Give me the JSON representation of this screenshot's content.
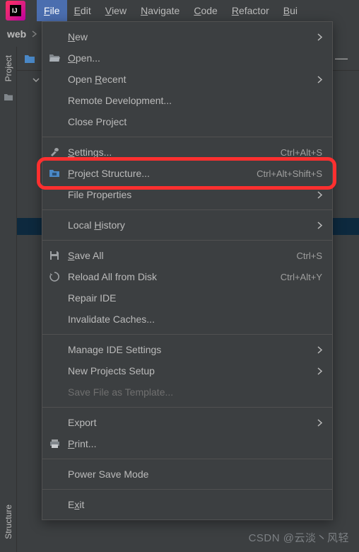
{
  "menubar": {
    "items": [
      "File",
      "Edit",
      "View",
      "Navigate",
      "Code",
      "Refactor",
      "Bui"
    ],
    "active_index": 0
  },
  "navbar": {
    "label": "web"
  },
  "sidebar": {
    "items": [
      {
        "label": "Project",
        "icon": "folder-icon"
      },
      {
        "label": "Structure",
        "icon": "structure-icon"
      }
    ]
  },
  "dropdown": {
    "items": [
      {
        "type": "item",
        "icon": "",
        "label": "New",
        "shortcut": "",
        "submenu": true,
        "mnemonic_idx": 0
      },
      {
        "type": "item",
        "icon": "folder-open-icon",
        "label": "Open...",
        "shortcut": "",
        "submenu": false,
        "mnemonic_idx": 0
      },
      {
        "type": "item",
        "icon": "",
        "label": "Open Recent",
        "shortcut": "",
        "submenu": true,
        "mnemonic_idx": 5
      },
      {
        "type": "item",
        "icon": "",
        "label": "Remote Development...",
        "shortcut": "",
        "submenu": false
      },
      {
        "type": "item",
        "icon": "",
        "label": "Close Project",
        "shortcut": "",
        "submenu": false
      },
      {
        "type": "sep"
      },
      {
        "type": "item",
        "icon": "wrench-icon",
        "label": "Settings...",
        "shortcut": "Ctrl+Alt+S",
        "submenu": false,
        "mnemonic_idx": 0
      },
      {
        "type": "item",
        "icon": "project-structure-icon",
        "label": "Project Structure...",
        "shortcut": "Ctrl+Alt+Shift+S",
        "submenu": false,
        "mnemonic_idx": 0
      },
      {
        "type": "item",
        "icon": "",
        "label": "File Properties",
        "shortcut": "",
        "submenu": true
      },
      {
        "type": "sep"
      },
      {
        "type": "item",
        "icon": "",
        "label": "Local History",
        "shortcut": "",
        "submenu": true,
        "mnemonic_idx": 6
      },
      {
        "type": "sep"
      },
      {
        "type": "item",
        "icon": "save-icon",
        "label": "Save All",
        "shortcut": "Ctrl+S",
        "submenu": false,
        "mnemonic_idx": 0
      },
      {
        "type": "item",
        "icon": "reload-icon",
        "label": "Reload All from Disk",
        "shortcut": "Ctrl+Alt+Y",
        "submenu": false
      },
      {
        "type": "item",
        "icon": "",
        "label": "Repair IDE",
        "shortcut": "",
        "submenu": false
      },
      {
        "type": "item",
        "icon": "",
        "label": "Invalidate Caches...",
        "shortcut": "",
        "submenu": false
      },
      {
        "type": "sep"
      },
      {
        "type": "item",
        "icon": "",
        "label": "Manage IDE Settings",
        "shortcut": "",
        "submenu": true
      },
      {
        "type": "item",
        "icon": "",
        "label": "New Projects Setup",
        "shortcut": "",
        "submenu": true
      },
      {
        "type": "item",
        "icon": "",
        "label": "Save File as Template...",
        "shortcut": "",
        "submenu": false,
        "disabled": true
      },
      {
        "type": "sep"
      },
      {
        "type": "item",
        "icon": "",
        "label": "Export",
        "shortcut": "",
        "submenu": true
      },
      {
        "type": "item",
        "icon": "print-icon",
        "label": "Print...",
        "shortcut": "",
        "submenu": false,
        "mnemonic_idx": 0
      },
      {
        "type": "sep"
      },
      {
        "type": "item",
        "icon": "",
        "label": "Power Save Mode",
        "shortcut": "",
        "submenu": false
      },
      {
        "type": "sep"
      },
      {
        "type": "item",
        "icon": "",
        "label": "Exit",
        "shortcut": "",
        "submenu": false,
        "mnemonic_idx": 1
      }
    ]
  },
  "watermark": "CSDN @云淡丶风轻"
}
